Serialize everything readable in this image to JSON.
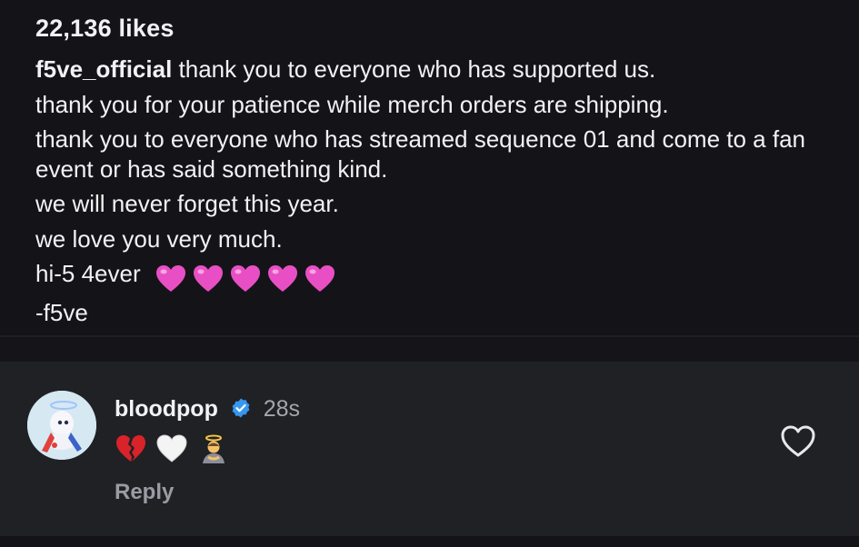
{
  "post": {
    "likes": "22,136 likes",
    "username": "f5ve_official",
    "caption_lines": [
      "thank you to everyone who has supported us.",
      "thank you for your patience while merch orders are shipping.",
      "thank you to everyone who has streamed sequence 01 and come to a fan event or has said something kind.",
      "we will never forget this year.",
      "we love you very much.",
      "hi-5 4ever",
      "-f5ve"
    ],
    "hearts_emoji_count": 5,
    "heart_color": "#e94fc4"
  },
  "comment": {
    "username": "bloodpop",
    "verified": true,
    "time": "28s",
    "emojis": [
      "broken-heart",
      "white-heart",
      "person-bowing-with-halo"
    ],
    "reply_label": "Reply"
  },
  "colors": {
    "background": "#141418",
    "comment_background": "#202125",
    "verified_blue": "#3797f0",
    "muted_text": "#a3a6ad"
  }
}
